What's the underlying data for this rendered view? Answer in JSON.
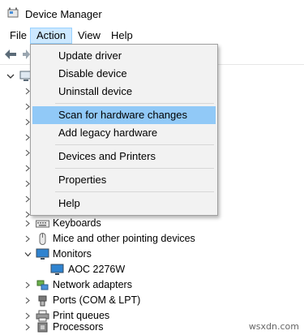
{
  "window": {
    "title": "Device Manager"
  },
  "menubar": {
    "items": [
      "File",
      "Action",
      "View",
      "Help"
    ],
    "active": "Action"
  },
  "action_menu": {
    "items": [
      {
        "label": "Update driver"
      },
      {
        "label": "Disable device"
      },
      {
        "label": "Uninstall device"
      },
      {
        "label": "Scan for hardware changes",
        "highlighted": true
      },
      {
        "label": "Add legacy hardware"
      },
      {
        "label": "Devices and Printers"
      },
      {
        "label": "Properties"
      },
      {
        "label": "Help"
      }
    ]
  },
  "tree": {
    "nodes": [
      {
        "label": "Keyboards",
        "icon": "keyboard-icon",
        "expanded": false
      },
      {
        "label": "Mice and other pointing devices",
        "icon": "mouse-icon",
        "expanded": false
      },
      {
        "label": "Monitors",
        "icon": "monitor-icon",
        "expanded": true
      },
      {
        "label": "AOC 2276W",
        "icon": "monitor-icon",
        "child": true
      },
      {
        "label": "Network adapters",
        "icon": "network-adapter-icon",
        "expanded": false
      },
      {
        "label": "Ports (COM & LPT)",
        "icon": "port-icon",
        "expanded": false
      },
      {
        "label": "Print queues",
        "icon": "printer-icon",
        "expanded": false
      },
      {
        "label": "Processors",
        "icon": "processor-icon",
        "expanded": false
      }
    ]
  },
  "watermark": "wsxdn.com",
  "colors": {
    "menu_highlight": "#91c9f7",
    "active_menu_bg": "#cce8ff",
    "menu_bg": "#f2f2f2"
  }
}
